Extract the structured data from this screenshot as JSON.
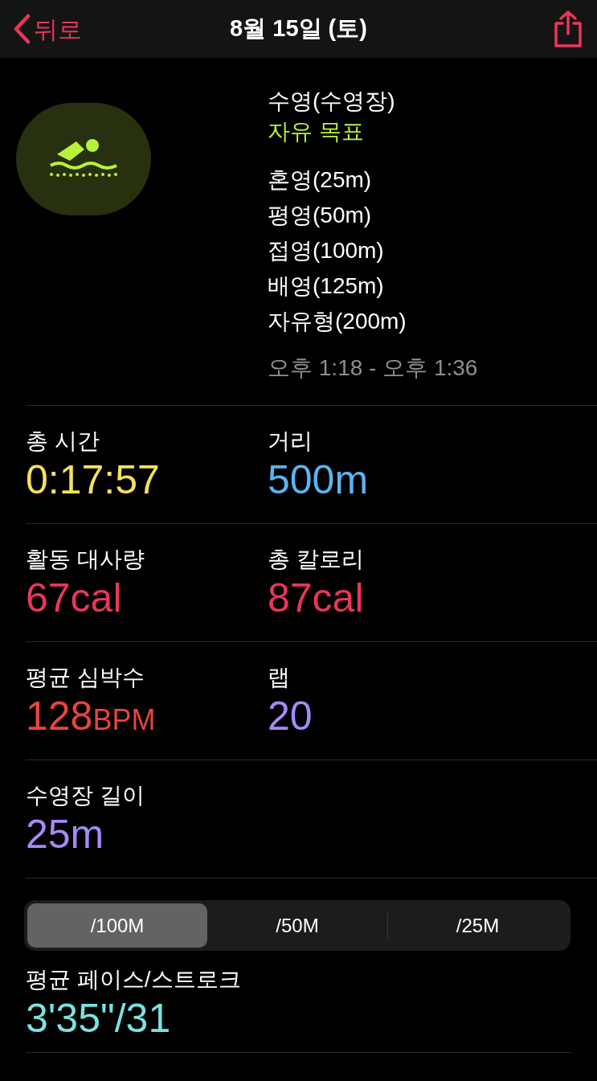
{
  "nav": {
    "back": "뒤로",
    "title": "8월 15일 (토)"
  },
  "workout": {
    "name": "수영(수영장)",
    "goal": "자유 목표",
    "strokes": [
      "혼영(25m)",
      "평영(50m)",
      "접영(100m)",
      "배영(125m)",
      "자유형(200m)"
    ],
    "time_range": "오후 1:18 - 오후 1:36"
  },
  "stat_rows": [
    [
      {
        "label": "총 시간",
        "value": "0:17:57",
        "color": "#f5e05e"
      },
      {
        "label": "거리",
        "value": "500m",
        "color": "#5ab4f0"
      }
    ],
    [
      {
        "label": "활동 대사량",
        "value": "67cal",
        "color": "#e8375a"
      },
      {
        "label": "총 칼로리",
        "value": "87cal",
        "color": "#e8375a"
      }
    ],
    [
      {
        "label": "평균 심박수",
        "value": "128",
        "unit": "BPM",
        "color": "#e8453c"
      },
      {
        "label": "랩",
        "value": "20",
        "color": "#a58af5"
      }
    ],
    [
      {
        "label": "수영장 길이",
        "value": "25m",
        "color": "#a58af5"
      }
    ]
  ],
  "segments": [
    {
      "label": "/100M",
      "selected": true
    },
    {
      "label": "/50M",
      "selected": false
    },
    {
      "label": "/25M",
      "selected": false
    }
  ],
  "pace": {
    "label": "평균 페이스/스트로크",
    "value": "3'35\"/31",
    "color": "#7ee0e0"
  }
}
